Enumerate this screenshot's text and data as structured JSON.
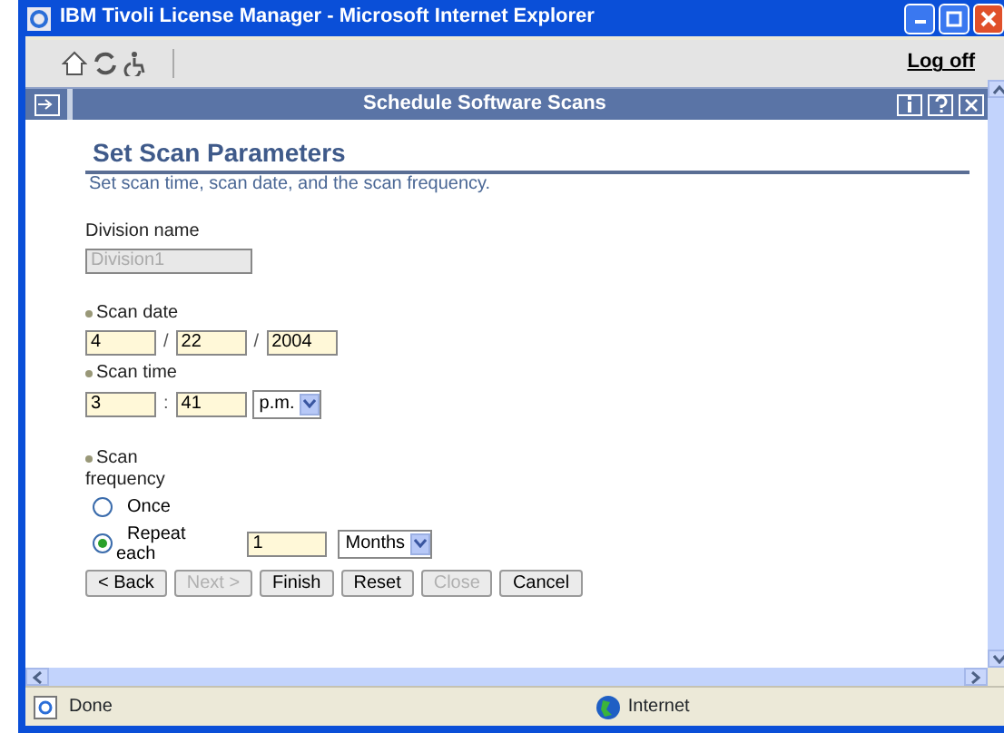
{
  "window": {
    "title": "IBM Tivoli License Manager - Microsoft Internet Explorer"
  },
  "toolbar": {
    "logoff": "Log off"
  },
  "portlet": {
    "title": "Schedule Software Scans"
  },
  "page": {
    "heading": "Set Scan Parameters",
    "description": "Set scan time, scan date, and the scan frequency."
  },
  "division": {
    "label": "Division name",
    "value": "Division1",
    "disabled": true
  },
  "scan_date": {
    "label": "Scan date",
    "required": true,
    "month": "4",
    "day": "22",
    "year": "2004",
    "separator": "/"
  },
  "scan_time": {
    "label": "Scan time",
    "required": true,
    "hour": "3",
    "minute": "41",
    "separator": ":",
    "ampm": "p.m."
  },
  "frequency": {
    "label_line1": "Scan",
    "label_line2": "frequency",
    "required": true,
    "options": [
      {
        "label": "Once",
        "selected": false
      },
      {
        "label_line1": "Repeat",
        "label_line2": "each",
        "selected": true
      }
    ],
    "repeat_value": "1",
    "repeat_unit": "Months"
  },
  "buttons": [
    {
      "label": "< Back",
      "disabled": false
    },
    {
      "label": "Next >",
      "disabled": true
    },
    {
      "label": "Finish",
      "disabled": false
    },
    {
      "label": "Reset",
      "disabled": false
    },
    {
      "label": "Close",
      "disabled": true
    },
    {
      "label": "Cancel",
      "disabled": false
    }
  ],
  "status_bar": {
    "text": "Done",
    "zone": "Internet"
  }
}
